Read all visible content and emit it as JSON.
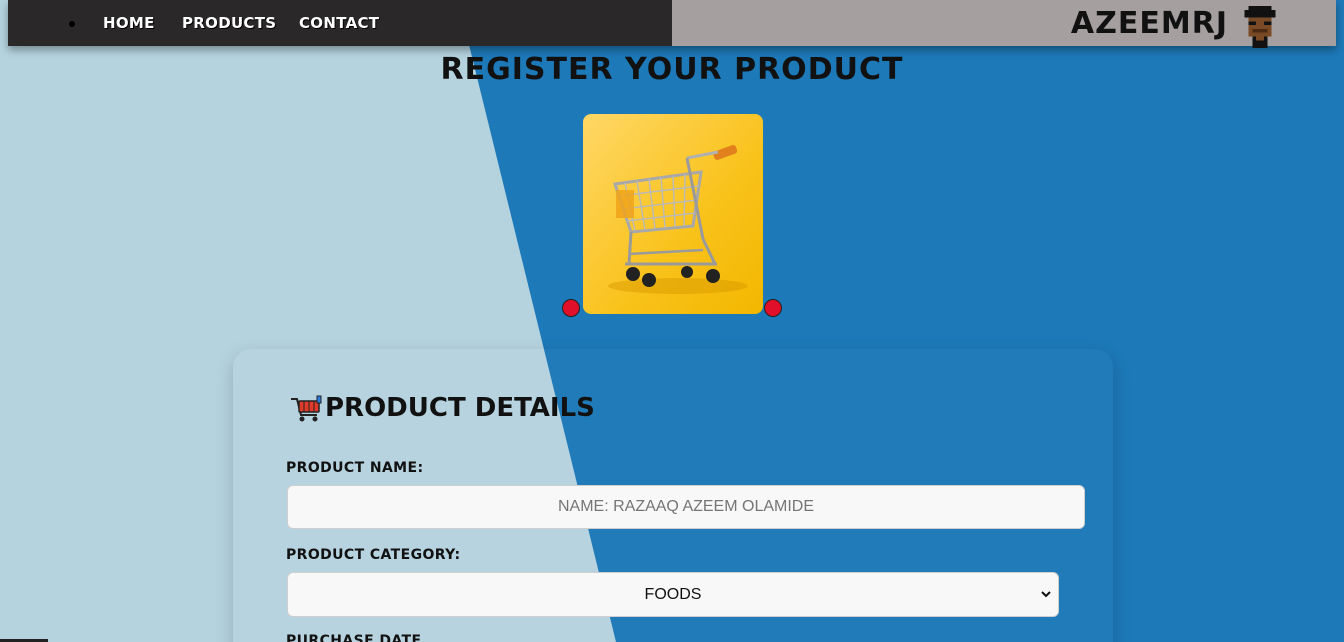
{
  "nav": {
    "items": [
      {
        "label": "HOME"
      },
      {
        "label": "PRODUCTS"
      },
      {
        "label": "CONTACT"
      }
    ],
    "brand": "AZEEMRJ",
    "avatar_icon": "pixel-avatar-icon"
  },
  "page": {
    "title": "REGISTER YOUR PRODUCT"
  },
  "hero": {
    "image": "shopping-cart-photo",
    "accent_color": "#e0102a"
  },
  "form": {
    "heading": "PRODUCT DETAILS",
    "heading_icon": "shopping-cart-icon",
    "product_name_label": "PRODUCT NAME:",
    "product_name_placeholder": "NAME: RAZAAQ AZEEM OLAMIDE",
    "product_category_label": "PRODUCT CATEGORY:",
    "product_category_value": "FOODS",
    "purchase_date_label": "PURCHASE DATE"
  },
  "colors": {
    "nav_dark": "#2a2829",
    "nav_light": "#a59f9f",
    "bg_light": "#b5d3df",
    "bg_blue": "#1d79b8"
  }
}
